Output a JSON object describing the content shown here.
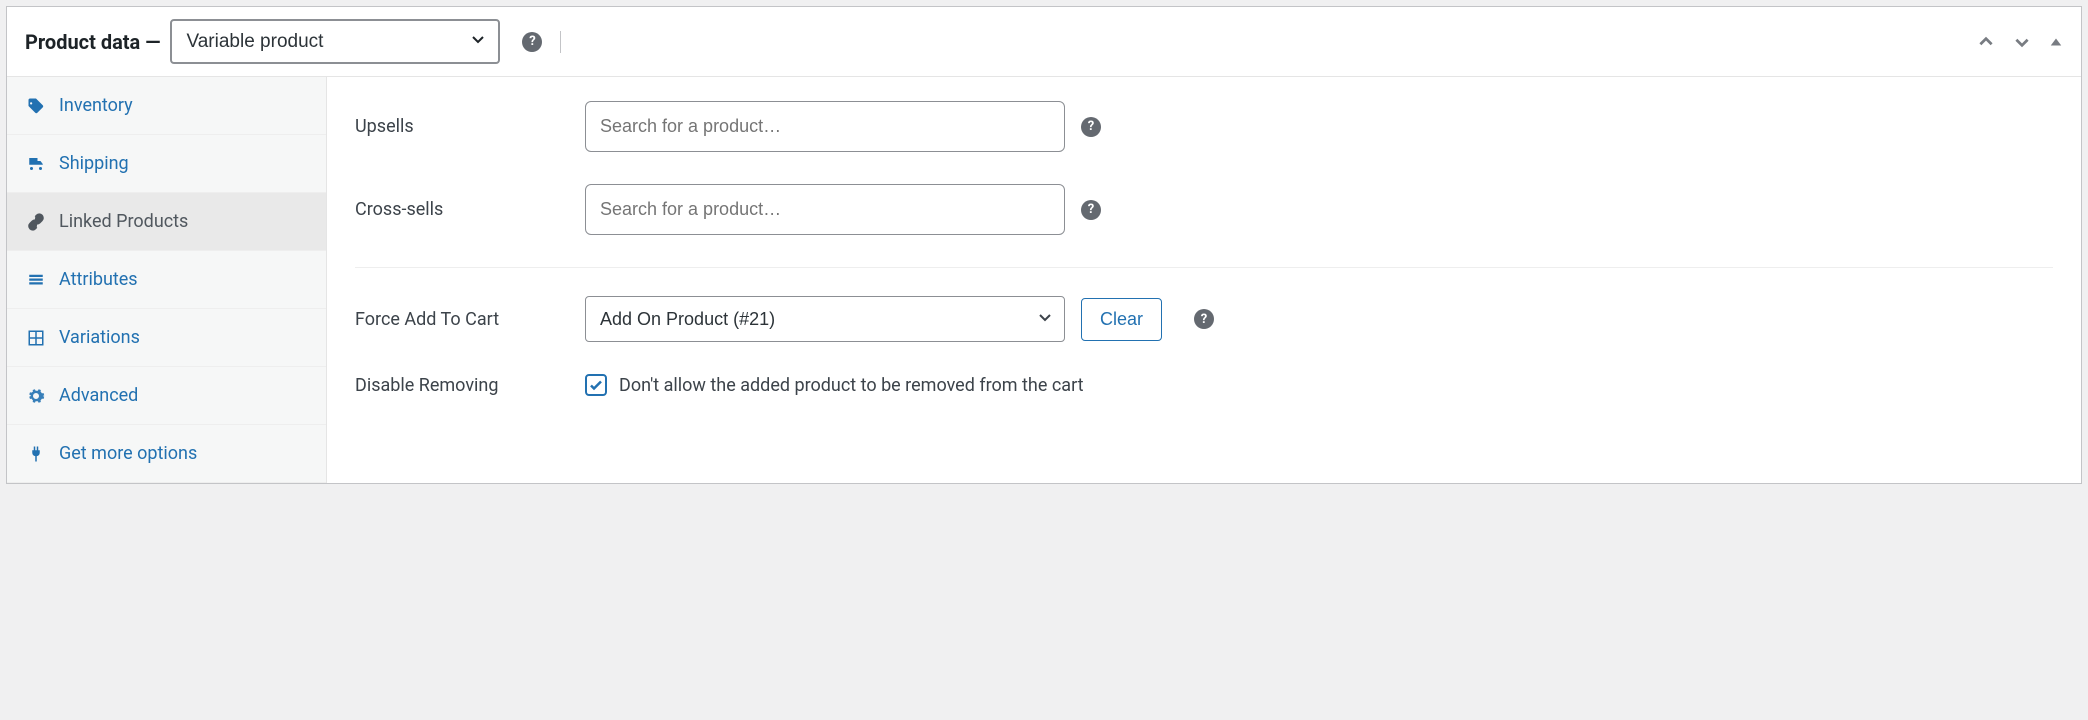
{
  "header": {
    "title": "Product data —",
    "product_type": "Variable product"
  },
  "sidebar": {
    "items": [
      {
        "label": "Inventory"
      },
      {
        "label": "Shipping"
      },
      {
        "label": "Linked Products"
      },
      {
        "label": "Attributes"
      },
      {
        "label": "Variations"
      },
      {
        "label": "Advanced"
      },
      {
        "label": "Get more options"
      }
    ]
  },
  "form": {
    "upsells": {
      "label": "Upsells",
      "placeholder": "Search for a product…"
    },
    "crosssells": {
      "label": "Cross-sells",
      "placeholder": "Search for a product…"
    },
    "force_add": {
      "label": "Force Add To Cart",
      "selected": "Add On Product (#21)",
      "clear_label": "Clear"
    },
    "disable_removing": {
      "label": "Disable Removing",
      "checkbox_label": "Don't allow the added product to be removed from the cart",
      "checked": true
    }
  }
}
